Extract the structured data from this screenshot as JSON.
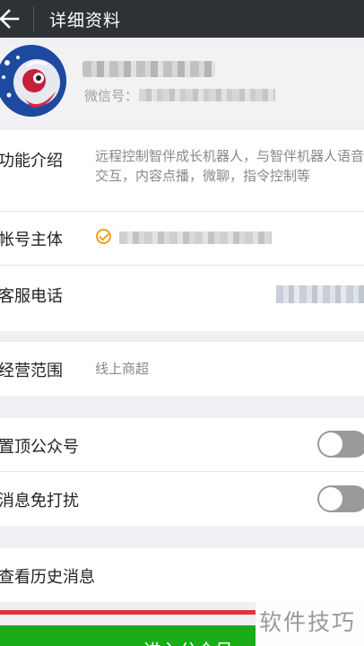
{
  "header": {
    "title": "详细资料"
  },
  "profile": {
    "wechat_id_label": "微信号："
  },
  "info": [
    {
      "label": "功能介绍",
      "value": "远程控制智伴成长机器人，与智伴机器人语音交互，内容点播，微聊，指令控制等"
    },
    {
      "label": "帐号主体"
    },
    {
      "label": "客服电话"
    }
  ],
  "scope": {
    "label": "经营范围",
    "value": "线上商超"
  },
  "settings": [
    {
      "label": "置顶公众号",
      "enabled": false
    },
    {
      "label": "消息免打扰",
      "enabled": false
    }
  ],
  "history": {
    "label": "查看历史消息"
  },
  "bottom_button": {
    "label": "进入公众号"
  },
  "watermark": "软件技巧"
}
